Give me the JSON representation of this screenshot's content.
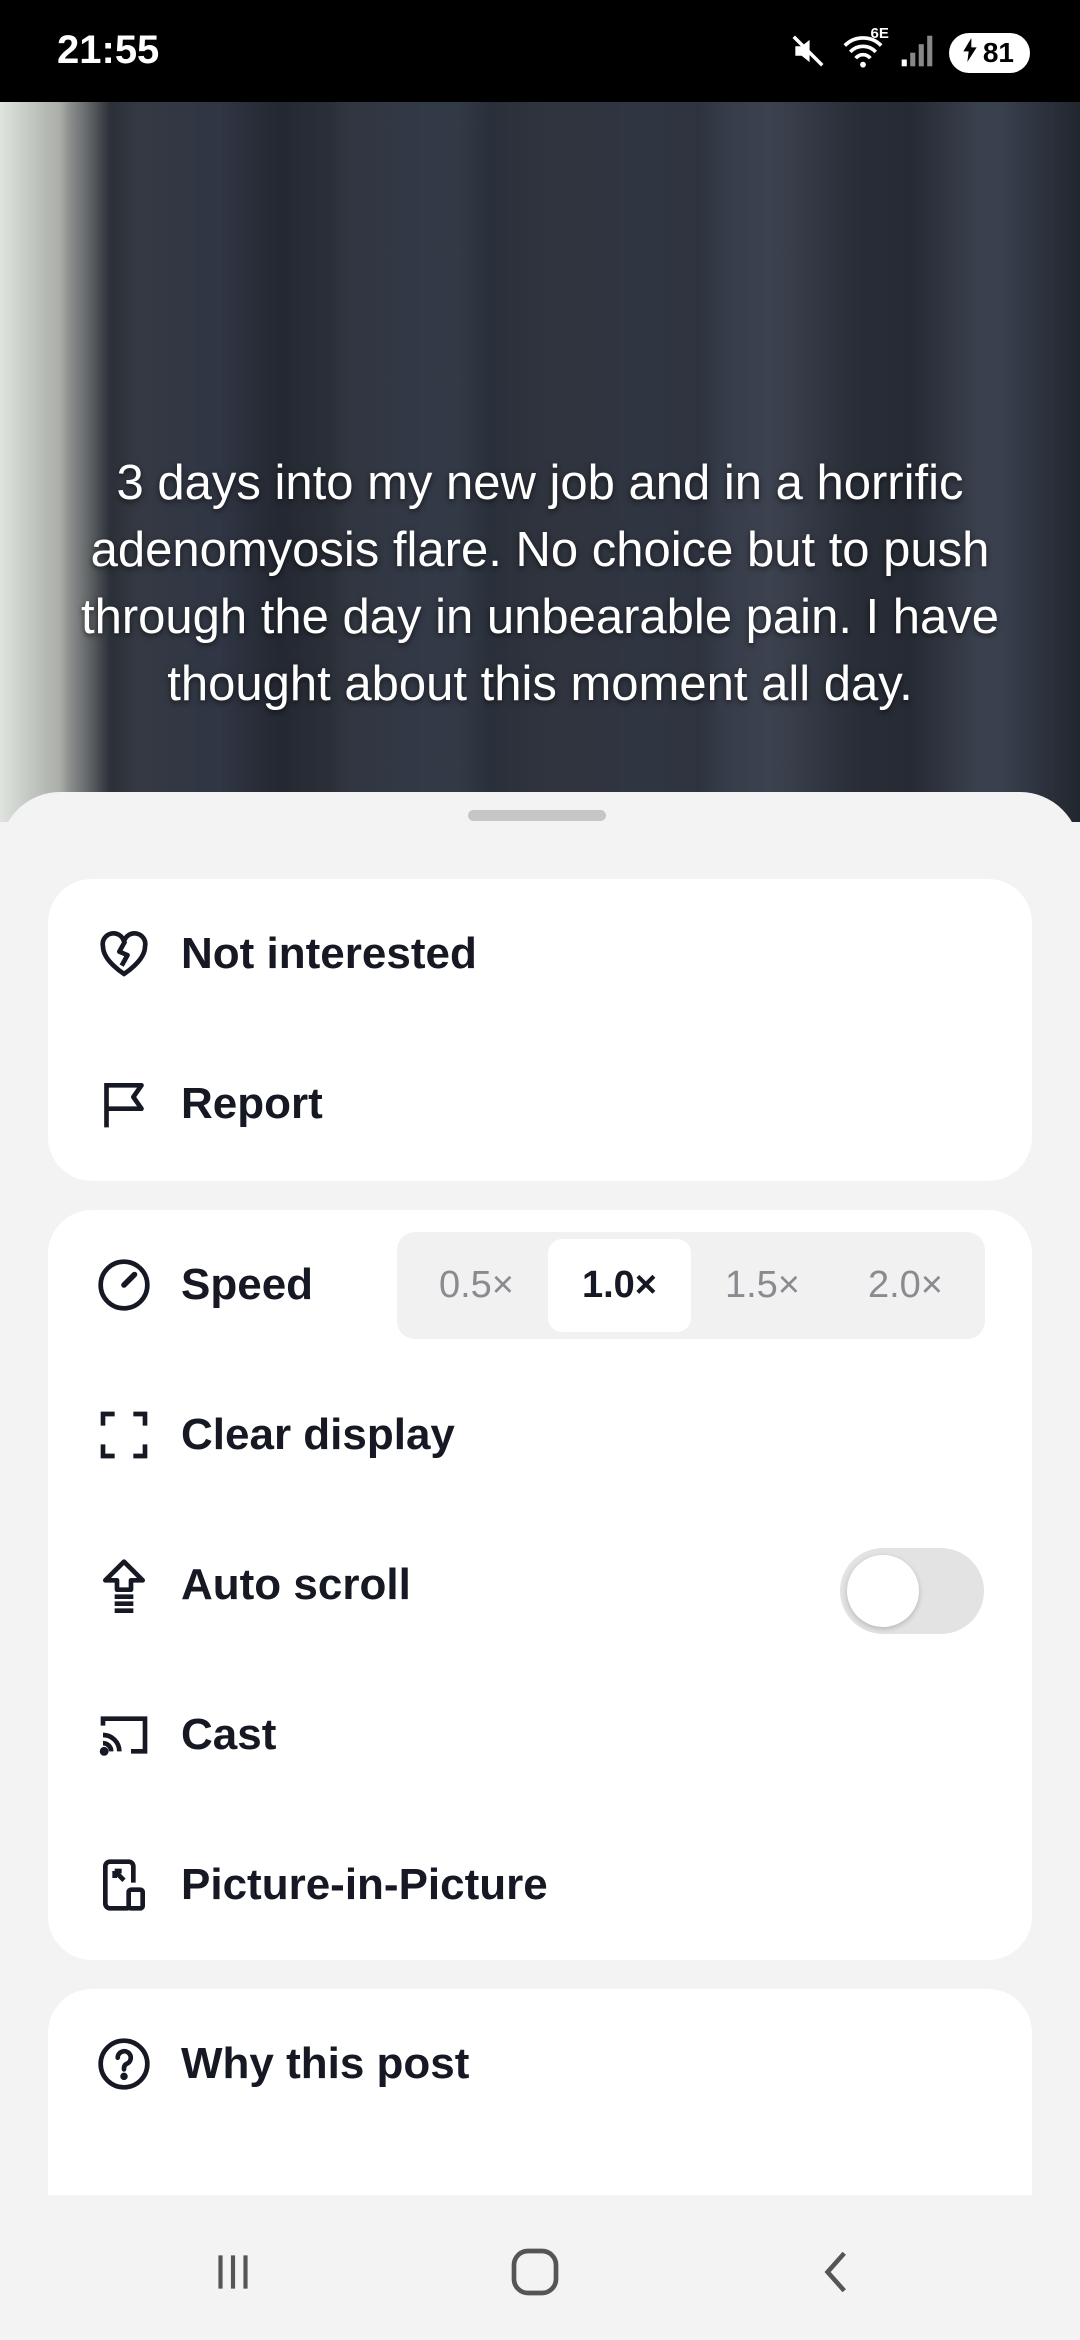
{
  "status_bar": {
    "time": "21:55",
    "network": "6E",
    "battery": "81",
    "icons": [
      "mute-icon",
      "wifi-icon",
      "signal-icon",
      "battery-icon"
    ]
  },
  "video": {
    "caption": "3 days into my new job and in a horrific adenomyosis flare. No choice but to push through the day in unbearable pain. I have thought about this moment all day."
  },
  "sheet": {
    "group1": [
      {
        "label": "Not interested",
        "icon": "broken-heart-icon"
      },
      {
        "label": "Report",
        "icon": "flag-icon"
      }
    ],
    "speed": {
      "label": "Speed",
      "icon": "speedometer-icon",
      "options": [
        "0.5×",
        "1.0×",
        "1.5×",
        "2.0×"
      ],
      "selected": "1.0×"
    },
    "group2": [
      {
        "label": "Clear display",
        "icon": "clear-display-icon"
      },
      {
        "label": "Auto scroll",
        "icon": "auto-scroll-icon",
        "toggle": false
      },
      {
        "label": "Cast",
        "icon": "cast-icon"
      },
      {
        "label": "Picture-in-Picture",
        "icon": "picture-in-picture-icon"
      }
    ],
    "group3": [
      {
        "label": "Why this post",
        "icon": "question-icon"
      }
    ]
  },
  "nav_bar": {
    "buttons": [
      "recent-apps-icon",
      "home-icon",
      "back-icon"
    ]
  }
}
